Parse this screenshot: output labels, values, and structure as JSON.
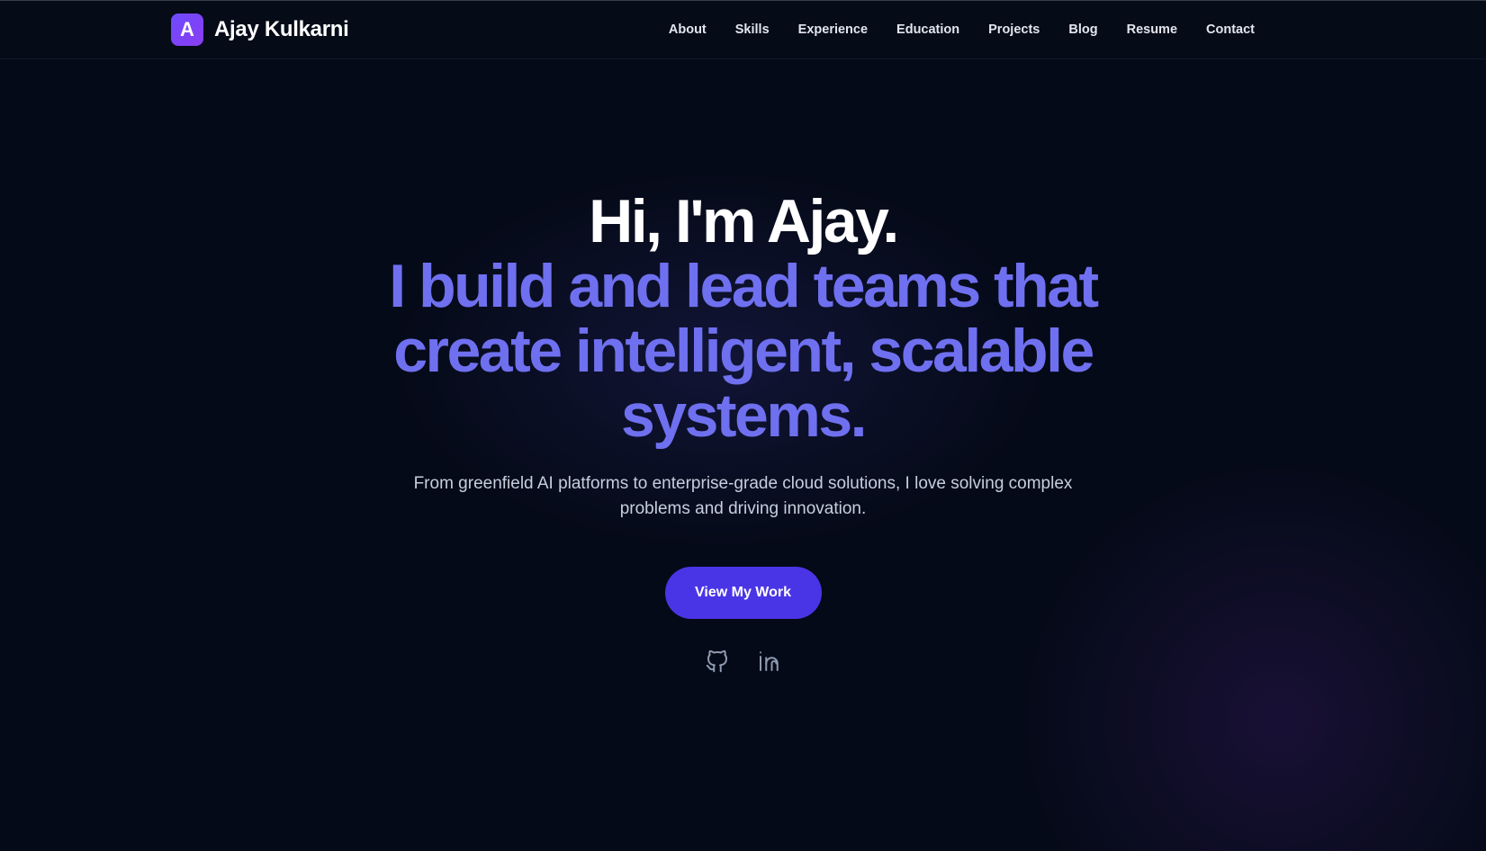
{
  "nav": {
    "logo_letter": "A",
    "brand_name": "Ajay Kulkarni",
    "links": [
      "About",
      "Skills",
      "Experience",
      "Education",
      "Projects",
      "Blog",
      "Resume",
      "Contact"
    ]
  },
  "hero": {
    "greeting": "Hi, I'm Ajay.",
    "tagline": "I build and lead teams that create intelligent, scalable systems.",
    "description": "From greenfield AI platforms to enterprise-grade cloud solutions, I love solving complex problems and driving innovation.",
    "cta_label": "View My Work"
  },
  "social": {
    "icons": [
      "github-icon",
      "linkedin-icon"
    ]
  },
  "colors": {
    "background": "#050a18",
    "accent_text": "#6f70ef",
    "button": "#4a35e6",
    "logo_gradient_start": "#6d4bff",
    "logo_gradient_end": "#8b3df0"
  }
}
